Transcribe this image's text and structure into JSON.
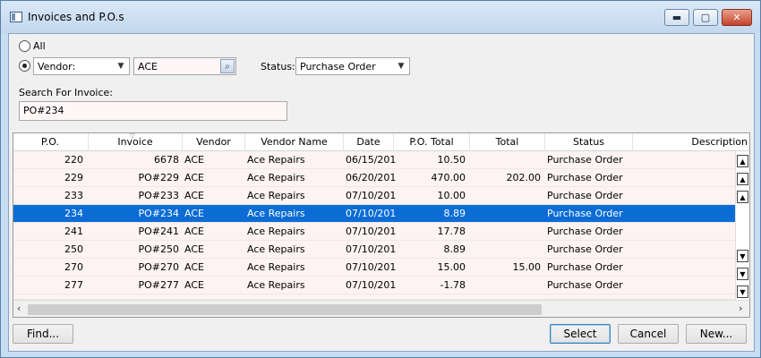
{
  "window": {
    "title": "Invoices and P.O.s",
    "min_glyph": "▬",
    "max_glyph": "▢",
    "close_glyph": "✕"
  },
  "filter": {
    "all_label": "All",
    "all_checked": false,
    "vendor_checked": true,
    "vendor_combo_value": "Vendor:",
    "vendor_value": "ACE",
    "status_label": "Status:",
    "status_value": "Purchase Order",
    "search_label": "Search For Invoice:",
    "search_value": "PO#234"
  },
  "grid": {
    "columns": [
      "P.O.",
      "Invoice",
      "Vendor",
      "Vendor Name",
      "Date",
      "P.O. Total",
      "Total",
      "Status",
      "Description"
    ],
    "selected_index": 3,
    "rows": [
      {
        "po": "220",
        "invoice": "6678",
        "vendor": "ACE",
        "vendor_name": "Ace Repairs",
        "date": "06/15/201",
        "po_total": "10.50",
        "total": "",
        "status": "Purchase Order",
        "description": ""
      },
      {
        "po": "229",
        "invoice": "PO#229",
        "vendor": "ACE",
        "vendor_name": "Ace Repairs",
        "date": "06/20/201",
        "po_total": "470.00",
        "total": "202.00",
        "status": "Purchase Order",
        "description": ""
      },
      {
        "po": "233",
        "invoice": "PO#233",
        "vendor": "ACE",
        "vendor_name": "Ace Repairs",
        "date": "07/10/201",
        "po_total": "10.00",
        "total": "",
        "status": "Purchase Order",
        "description": ""
      },
      {
        "po": "234",
        "invoice": "PO#234",
        "vendor": "ACE",
        "vendor_name": "Ace Repairs",
        "date": "07/10/201",
        "po_total": "8.89",
        "total": "",
        "status": "Purchase Order",
        "description": ""
      },
      {
        "po": "241",
        "invoice": "PO#241",
        "vendor": "ACE",
        "vendor_name": "Ace Repairs",
        "date": "07/10/201",
        "po_total": "17.78",
        "total": "",
        "status": "Purchase Order",
        "description": ""
      },
      {
        "po": "250",
        "invoice": "PO#250",
        "vendor": "ACE",
        "vendor_name": "Ace Repairs",
        "date": "07/10/201",
        "po_total": "8.89",
        "total": "",
        "status": "Purchase Order",
        "description": ""
      },
      {
        "po": "270",
        "invoice": "PO#270",
        "vendor": "ACE",
        "vendor_name": "Ace Repairs",
        "date": "07/10/201",
        "po_total": "15.00",
        "total": "15.00",
        "status": "Purchase Order",
        "description": ""
      },
      {
        "po": "277",
        "invoice": "PO#277",
        "vendor": "ACE",
        "vendor_name": "Ace Repairs",
        "date": "07/10/201",
        "po_total": "-1.78",
        "total": "",
        "status": "Purchase Order",
        "description": ""
      }
    ]
  },
  "buttons": {
    "find": "Find...",
    "select": "Select",
    "cancel": "Cancel",
    "new": "New..."
  },
  "colors": {
    "selection": "#0a6cd4",
    "row_background": "#fdf3f3"
  }
}
